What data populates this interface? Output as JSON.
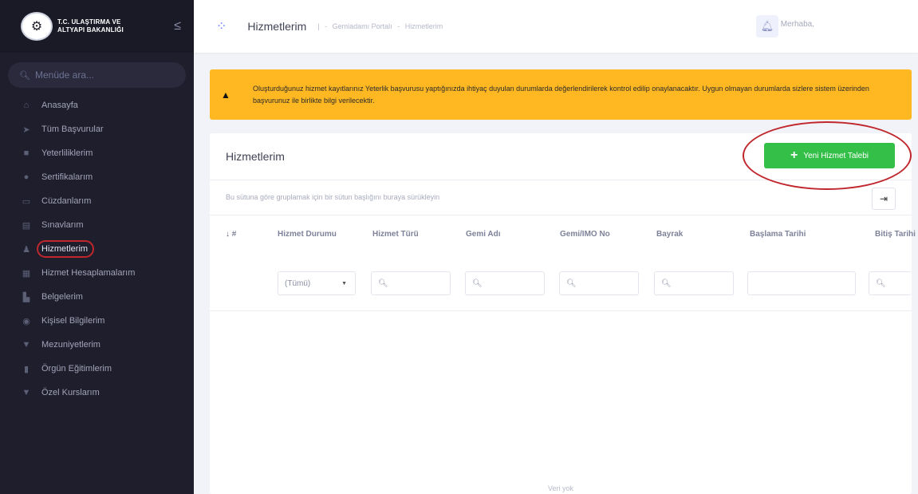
{
  "brand": {
    "line1": "T.C. ULAŞTIRMA VE",
    "line2": "ALTYAPI BAKANLIĞI"
  },
  "sidebar": {
    "search_placeholder": "Menüde ara...",
    "items": [
      {
        "label": "Anasayfa",
        "icon": "home-icon"
      },
      {
        "label": "Tüm Başvurular",
        "icon": "send-icon"
      },
      {
        "label": "Yeterliliklerim",
        "icon": "briefcase-icon"
      },
      {
        "label": "Sertifikalarım",
        "icon": "dot-icon"
      },
      {
        "label": "Cüzdanlarım",
        "icon": "wallet-icon"
      },
      {
        "label": "Sınavlarım",
        "icon": "document-icon"
      },
      {
        "label": "Hizmetlerim",
        "icon": "user-icon"
      },
      {
        "label": "Hizmet Hesaplamalarım",
        "icon": "calculator-icon"
      },
      {
        "label": "Belgelerim",
        "icon": "files-icon"
      },
      {
        "label": "Kişisel Bilgilerim",
        "icon": "person-icon"
      },
      {
        "label": "Mezuniyetlerim",
        "icon": "graduation-icon"
      },
      {
        "label": "Örgün Eğitimlerim",
        "icon": "book-icon"
      },
      {
        "label": "Özel Kurslarım",
        "icon": "cap-icon"
      }
    ]
  },
  "topbar": {
    "title": "Hizmetlerim",
    "crumb1": "Gemiadamı Portalı",
    "crumb2": "Hizmetlerim",
    "greeting": "Merhaba,"
  },
  "alert": {
    "text": "Oluşturduğunuz hizmet kayıtlarınız Yeterlik başvurusu yaptığınızda ihtiyaç duyulan durumlarda değerlendirilerek kontrol edilip onaylanacaktır. Uygun olmayan durumlarda sizlere sistem üzerinden başvurunuz ile birlikte bilgi verilecektir."
  },
  "panel": {
    "title": "Hizmetlerim",
    "new_button": "Yeni Hizmet Talebi",
    "group_hint": "Bu sütuna göre gruplamak için bir sütun başlığını buraya sürükleyin",
    "columns": [
      "↓ #",
      "Hizmet Durumu",
      "Hizmet Türü",
      "Gemi Adı",
      "Gemi/IMO No",
      "Bayrak",
      "Başlama Tarihi",
      "Bitiş Tarihi"
    ],
    "status_filter": "(Tümü)",
    "search_glyph": "🔍︎",
    "empty": "Veri yok"
  },
  "colors": {
    "sidebar_bg": "#1e1e2d",
    "alert_bg": "#ffb822",
    "primary_button": "#34bf49",
    "highlight_circle": "#c0272d"
  }
}
